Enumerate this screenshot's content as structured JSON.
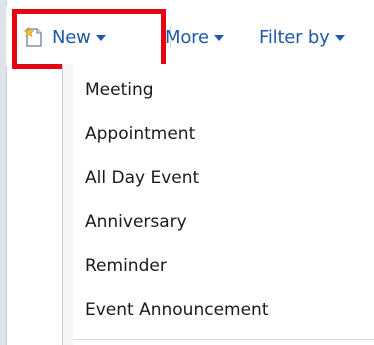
{
  "toolbar": {
    "new_label": "New",
    "more_label": "More",
    "filter_label": "Filter by"
  },
  "icons": {
    "new": "new-item-icon",
    "dropdown": "chevron-down-icon"
  },
  "colors": {
    "toolbar_link": "#1e5aa8",
    "highlight": "#e30613",
    "menu_text": "#1a1a1a"
  },
  "new_menu": {
    "items": [
      {
        "label": "Meeting"
      },
      {
        "label": "Appointment"
      },
      {
        "label": "All Day Event"
      },
      {
        "label": "Anniversary"
      },
      {
        "label": "Reminder"
      },
      {
        "label": "Event Announcement"
      }
    ]
  }
}
